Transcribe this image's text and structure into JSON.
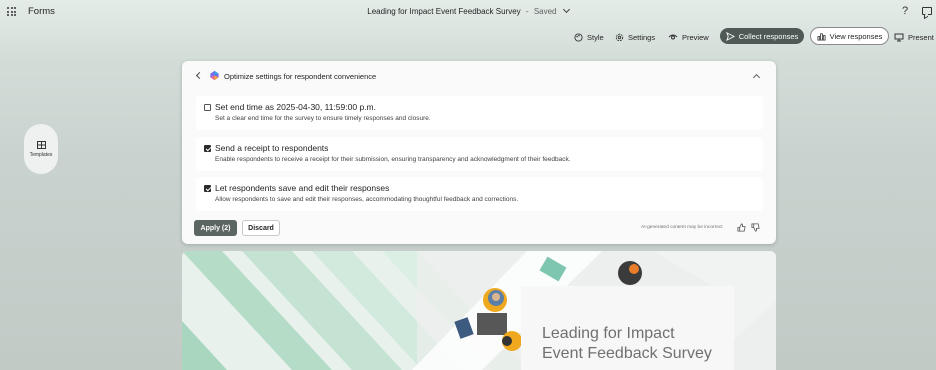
{
  "app": {
    "name": "Forms",
    "doc_title": "Leading for Impact Event Feedback Survey",
    "separator": "-",
    "status": "Saved"
  },
  "toolbar": {
    "style_label": "Style",
    "settings_label": "Settings",
    "preview_label": "Preview",
    "collect_label": "Collect responses",
    "view_label": "View responses",
    "present_label": "Present"
  },
  "side": {
    "templates_label": "Templates"
  },
  "suggestions": {
    "title": "Optimize settings for respondent convenience",
    "options": [
      {
        "title": "Set end time as 2025-04-30, 11:59:00 p.m.",
        "description": "Set a clear end time for the survey to ensure timely responses and closure.",
        "checked": false
      },
      {
        "title": "Send a receipt to respondents",
        "description": "Enable respondents to receive a receipt for their submission, ensuring transparency and acknowledgment of their feedback.",
        "checked": true
      },
      {
        "title": "Let respondents save and edit their responses",
        "description": "Allow respondents to save and edit their responses, accommodating thoughtful feedback and corrections.",
        "checked": true
      }
    ],
    "apply_label": "Apply (2)",
    "discard_label": "Discard",
    "ai_note": "AI-generated content may be incorrect"
  },
  "banner": {
    "title_line1": "Leading for Impact",
    "title_line2": "Event Feedback Survey"
  },
  "colors": {
    "collect_button": "#4f5a57",
    "apply_button": "#5b6663",
    "banner_green": "#a9d6bf"
  }
}
